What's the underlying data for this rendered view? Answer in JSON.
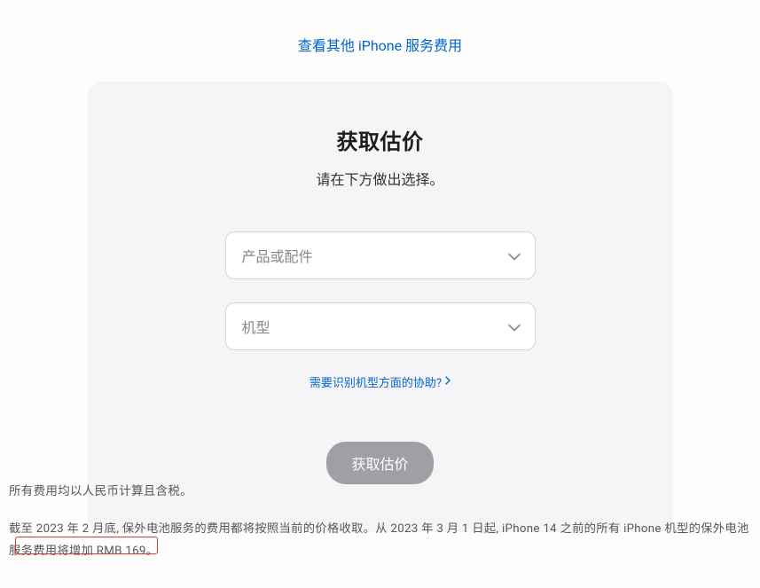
{
  "topLink": "查看其他 iPhone 服务费用",
  "card": {
    "title": "获取估价",
    "subtitle": "请在下方做出选择。",
    "select1Placeholder": "产品或配件",
    "select2Placeholder": "机型",
    "helpLink": "需要识别机型方面的协助?",
    "button": "获取估价"
  },
  "footer": {
    "taxNote": "所有费用均以人民币计算且含税。",
    "priceNote": "截至 2023 年 2 月底, 保外电池服务的费用都将按照当前的价格收取。从 2023 年 3 月 1 日起, iPhone 14 之前的所有 iPhone 机型的保外电池服务费用将增加 RMB 169。"
  }
}
